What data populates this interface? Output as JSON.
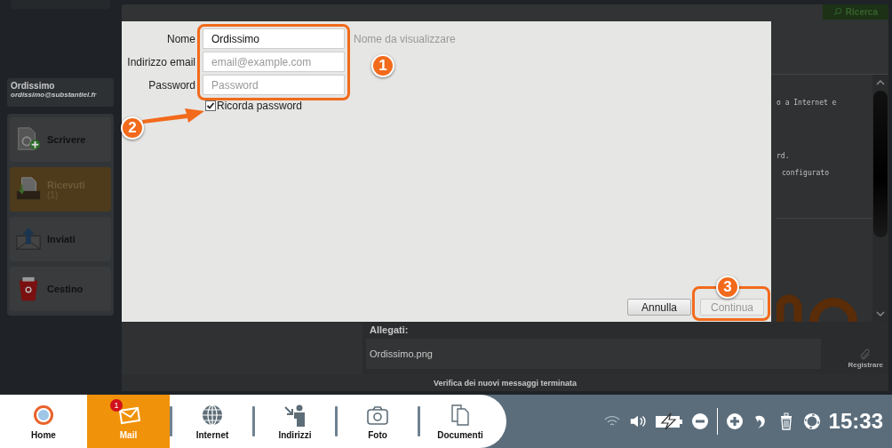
{
  "sidebar": {
    "account": {
      "name": "Ordissimo",
      "email": "ordissimo@substantiel.fr"
    },
    "folders": [
      {
        "kind": "compose",
        "label": "Scrivere",
        "selected": false
      },
      {
        "kind": "inbox",
        "label": "Ricevuti",
        "count": "(1)",
        "selected": true
      },
      {
        "kind": "sent",
        "label": "Inviati",
        "selected": false
      },
      {
        "kind": "trash",
        "label": "Cestino",
        "selected": false
      }
    ]
  },
  "top_bar": {
    "search_button": "Ricerca"
  },
  "message": {
    "lines": [
      "o a Internet e",
      "rd.",
      "configurato"
    ]
  },
  "attachments": {
    "label": "Allegati:",
    "files": [
      "Ordissimo.png"
    ],
    "save_button": "Registrare"
  },
  "status_bar": "Verifica dei nuovi messaggi terminata",
  "dialog": {
    "fields": [
      {
        "label": "Nome",
        "value": "Ordissimo"
      },
      {
        "label": "Indirizzo email",
        "placeholder": "email@example.com"
      },
      {
        "label": "Password",
        "placeholder": "Password"
      }
    ],
    "name_hint": "Nome da visualizzare",
    "remember": {
      "label": "Ricorda password",
      "checked": true
    },
    "buttons": [
      {
        "label": "Annulla",
        "disabled": false
      },
      {
        "label": "Continua",
        "disabled": true
      }
    ]
  },
  "annotations": [
    {
      "number": "1"
    },
    {
      "number": "2"
    },
    {
      "number": "3"
    }
  ],
  "taskbar": {
    "apps": [
      {
        "kind": "home",
        "label": "Home",
        "selected": false
      },
      {
        "kind": "mail",
        "label": "Mail",
        "selected": true,
        "badge": "1"
      },
      {
        "kind": "internet",
        "label": "Internet",
        "selected": false
      },
      {
        "kind": "contacts",
        "label": "Indirizzi",
        "selected": false
      },
      {
        "kind": "photo",
        "label": "Foto",
        "selected": false
      },
      {
        "kind": "documents",
        "label": "Documenti",
        "selected": false
      }
    ],
    "clock": "15:33"
  }
}
